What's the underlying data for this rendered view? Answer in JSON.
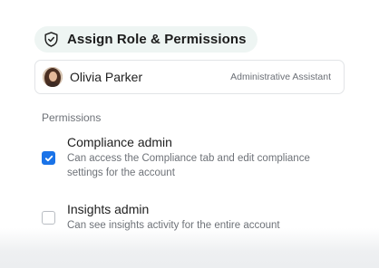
{
  "header": {
    "title": "Assign Role & Permissions",
    "icon": "shield-check-icon"
  },
  "user": {
    "name": "Olivia Parker",
    "role": "Administrative Assistant"
  },
  "permissions": {
    "section_label": "Permissions",
    "items": [
      {
        "title": "Compliance admin",
        "description": "Can access the Compliance tab and edit compliance settings for the account",
        "checked": true
      },
      {
        "title": "Insights admin",
        "description": "Can see insights activity for the entire account",
        "checked": false
      }
    ]
  },
  "colors": {
    "accent": "#1a73e8",
    "chip_background": "#eef5f3"
  }
}
